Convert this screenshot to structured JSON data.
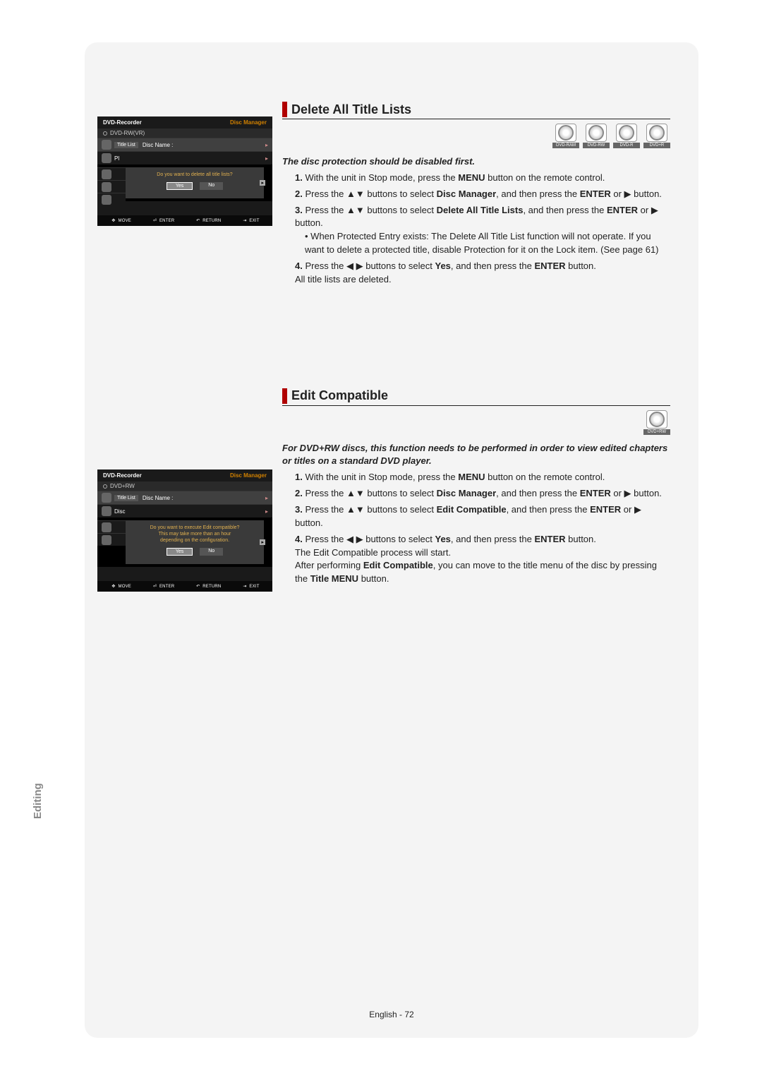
{
  "sideTab": "Editing",
  "footer": {
    "lang": "English",
    "page": "72"
  },
  "section1": {
    "title": "Delete All Title Lists",
    "discBadges": [
      "DVD-RAM",
      "DVD-RW",
      "DVD-R",
      "DVD+R"
    ],
    "note": "The disc protection should be disabled first.",
    "steps": [
      {
        "pre": "With the unit in Stop mode, press the ",
        "b1": "MENU",
        "post": " button on the remote control."
      },
      {
        "pre": "Press the ▲▼ buttons to select ",
        "b1": "Disc Manager",
        "mid": ", and then press the ",
        "b2": "ENTER",
        "post": " or ▶ button."
      },
      {
        "pre": "Press the ▲▼ buttons to select ",
        "b1": "Delete All Title Lists",
        "mid": ", and then press the ",
        "b2": "ENTER",
        "post": " or ▶ button.",
        "sub": "When Protected Entry exists: The Delete All Title List function will not operate. If you want to delete a protected title, disable Protection for it on the Lock item. (See page 61)"
      },
      {
        "pre": "Press the ◀ ▶ buttons to select ",
        "b1": "Yes",
        "mid": ", and then press the ",
        "b2": "ENTER",
        "post": " button.",
        "tail": "All title lists are deleted."
      }
    ]
  },
  "section2": {
    "title": "Edit Compatible",
    "discBadges": [
      "DVD+RW"
    ],
    "note": "For DVD+RW discs, this function needs to be performed in order to view edited chapters or titles on a standard DVD player.",
    "steps": [
      {
        "pre": "With the unit in Stop mode, press the ",
        "b1": "MENU",
        "post": " button on the remote control."
      },
      {
        "pre": "Press the ▲▼ buttons to select ",
        "b1": "Disc Manager",
        "mid": ", and then press the ",
        "b2": "ENTER",
        "post": " or ▶ button."
      },
      {
        "pre": "Press the ▲▼ buttons to select ",
        "b1": "Edit Compatible",
        "mid": ", and then press the ",
        "b2": "ENTER",
        "post": " or ▶ button."
      },
      {
        "pre": "Press the ◀ ▶ buttons to select ",
        "b1": "Yes",
        "mid": ", and then press the ",
        "b2": "ENTER",
        "post": " button.",
        "tail": "The Edit Compatible process will start.",
        "tail2a": "After performing ",
        "tail2b": "Edit Compatible",
        "tail2c": ", you can move to the title menu of the disc by pressing the ",
        "tail2d": "Title MENU",
        "tail2e": " button."
      }
    ]
  },
  "osd1": {
    "headerL": "DVD-Recorder",
    "headerR": "Disc Manager",
    "disc": "DVD-RW(VR)",
    "rowTab": "Title List",
    "rowLabel": "Disc Name  :",
    "dialogMsg": "Do you want to delete all title lists?",
    "yes": "Yes",
    "no": "No",
    "footer": {
      "move": "MOVE",
      "enter": "ENTER",
      "return": "RETURN",
      "exit": "EXIT"
    }
  },
  "osd2": {
    "headerL": "DVD-Recorder",
    "headerR": "Disc Manager",
    "disc": "DVD+RW",
    "rowTab": "Title List",
    "rowLabel": "Disc Name  :",
    "dialogLine1": "Do you want to execute Edit compatible?",
    "dialogLine2": "This may take more than an hour",
    "dialogLine3": "depending on the configuration.",
    "yes": "Yes",
    "no": "No",
    "footer": {
      "move": "MOVE",
      "enter": "ENTER",
      "return": "RETURN",
      "exit": "EXIT"
    }
  }
}
